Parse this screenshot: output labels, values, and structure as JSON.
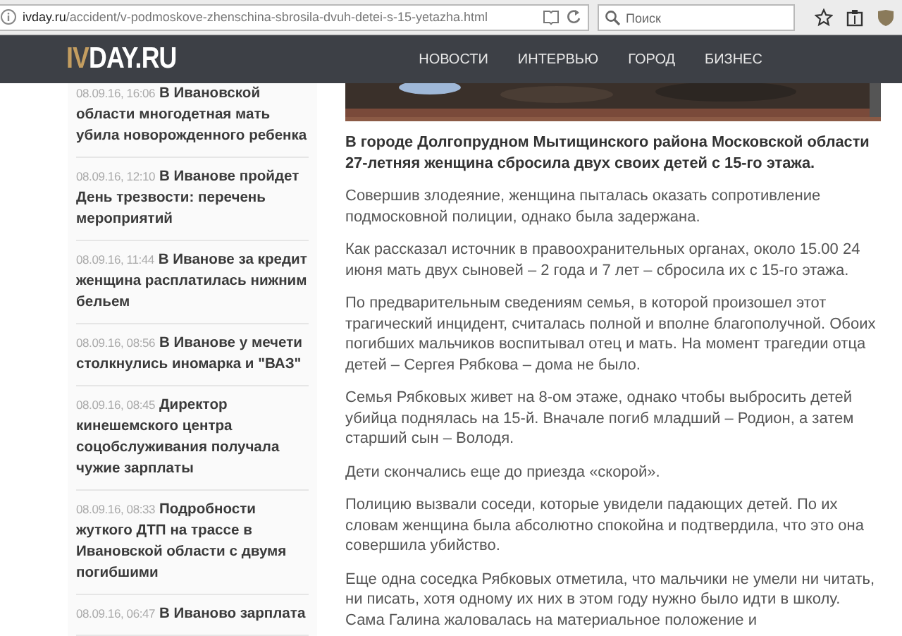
{
  "browser": {
    "url_domain": "ivday.ru",
    "url_path": "/accident/v-podmoskove-zhenschina-sbrosila-dvuh-detei-s-15-yetazha.html",
    "search_placeholder": "Поиск"
  },
  "header": {
    "logo_accent": "IV",
    "logo_rest": "DAY.RU",
    "nav": [
      "НОВОСТИ",
      "ИНТЕРВЬЮ",
      "ГОРОД",
      "БИЗНЕС"
    ]
  },
  "sidebar": {
    "items": [
      {
        "time": "08.09.16, 16:06",
        "title": "В Ивановской области многодетная мать убила новорожденного ребенка"
      },
      {
        "time": "08.09.16, 12:10",
        "title": "В Иванове пройдет День трезвости: перечень мероприятий"
      },
      {
        "time": "08.09.16, 11:44",
        "title": "В Иванове за кредит женщина расплатилась нижним бельем"
      },
      {
        "time": "08.09.16, 08:56",
        "title": "В Иванове у мечети столкнулись иномарка и \"ВАЗ\""
      },
      {
        "time": "08.09.16, 08:45",
        "title": "Директор кинешемского центра соцобслуживания получала чужие зарплаты"
      },
      {
        "time": "08.09.16, 08:33",
        "title": "Подробности жуткого ДТП на трассе в Ивановской области с двумя погибшими"
      },
      {
        "time": "08.09.16, 06:47",
        "title": "В Иваново зарплата"
      }
    ]
  },
  "article": {
    "lead": "В городе Долгопрудном Мытищинского района Московской области 27-летняя женщина сбросила двух своих детей с 15-го этажа.",
    "paragraphs": [
      "Совершив злодеяние, женщина пыталась оказать сопротивление подмосковной полиции, однако была задержана.",
      "Как рассказал источник в правоохранительных органах, около 15.00 24 июня мать двух сыновей – 2 года и 7 лет – сбросила их с 15-го этажа.",
      "По предварительным сведениям семья, в которой произошел этот трагический инцидент, считалась полной и вполне благополучной. Обоих погибших мальчиков воспитывал отец и мать. На момент трагедии отца детей – Сергея Рябкова – дома не было.",
      "Семья Рябковых живет на 8-ом этаже, однако чтобы выбросить детей убийца поднялась на 15-й. Вначале погиб младший – Родион, а затем старший сын – Володя.",
      "Дети скончались еще до приезда «скорой».",
      "Полицию вызвали соседи, которые увидели падающих детей. По их словам женщина была абсолютно спокойна и подтвердила, что это она совершила убийство.",
      "Еще одна соседка Рябковых отметила, что мальчики не умели ни читать, ни писать, хотя одному их них в этом году нужно было идти в школу. Сама Галина жаловалась на материальное положение и"
    ]
  }
}
